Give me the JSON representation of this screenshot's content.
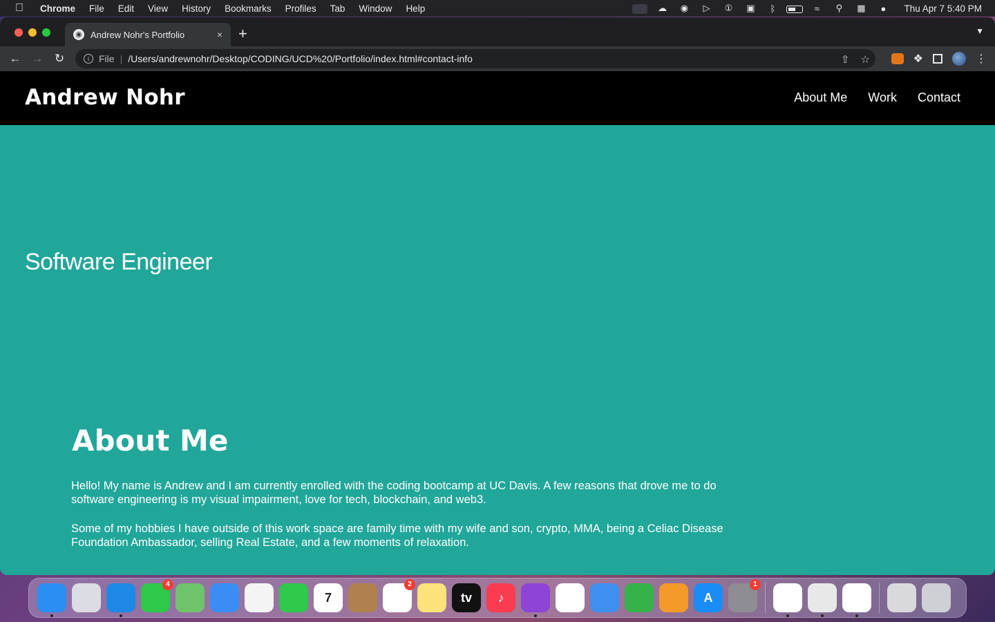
{
  "menubar": {
    "app_name": "Chrome",
    "items": [
      "File",
      "Edit",
      "View",
      "History",
      "Bookmarks",
      "Profiles",
      "Tab",
      "Window",
      "Help"
    ],
    "clock": "Thu Apr 7  5:40 PM"
  },
  "browser": {
    "tab_title": "Andrew Nohr's Portfolio",
    "tab_close": "×",
    "new_tab": "+",
    "scheme_label": "File",
    "url": "/Users/andrewnohr/Desktop/CODING/UCD%20/Portfolio/index.html#contact-info"
  },
  "site": {
    "brand": "Andrew Nohr",
    "nav": [
      "About Me",
      "Work",
      "Contact"
    ],
    "hero_title": "Software Engineer",
    "about_heading": "About Me",
    "about_paragraphs": [
      "Hello! My name is Andrew and I am currently enrolled with the coding bootcamp at UC Davis. A few reasons that drove me to do software engineering is my visual impairment, love for tech, blockchain, and web3.",
      "Some of my hobbies I have outside of this work space are family time with my wife and son, crypto, MMA, being a Celiac Disease Foundation Ambassador, selling Real Estate, and a few moments of relaxation."
    ],
    "colors": {
      "page_bg": "#21a69a",
      "header_bg": "#000000",
      "text": "#ffffff"
    }
  },
  "dock": {
    "apps": [
      {
        "name": "finder-icon",
        "color": "#2a8ef2",
        "running": true
      },
      {
        "name": "launchpad-icon",
        "color": "#dcdce4",
        "running": false
      },
      {
        "name": "safari-icon",
        "color": "#1e88e5",
        "running": true
      },
      {
        "name": "messages-icon",
        "color": "#2ec84b",
        "running": false,
        "badge": "4"
      },
      {
        "name": "maps-icon",
        "color": "#6fc36a",
        "running": false
      },
      {
        "name": "mail-icon",
        "color": "#3a8df5",
        "running": false
      },
      {
        "name": "photos-icon",
        "color": "#f4f4f4",
        "running": false
      },
      {
        "name": "facetime-icon",
        "color": "#2ec84b",
        "running": false
      },
      {
        "name": "calendar-icon",
        "color": "#ffffff",
        "running": false,
        "label": "7"
      },
      {
        "name": "contacts-icon",
        "color": "#b0814f",
        "running": false
      },
      {
        "name": "reminders-icon",
        "color": "#ffffff",
        "running": false,
        "badge": "2"
      },
      {
        "name": "notes-icon",
        "color": "#fbe27a",
        "running": false
      },
      {
        "name": "tv-icon",
        "color": "#111111",
        "running": false,
        "label": "tv"
      },
      {
        "name": "music-icon",
        "color": "#fa3c50",
        "running": false,
        "label": "♪"
      },
      {
        "name": "podcasts-icon",
        "color": "#8e44d6",
        "running": true
      },
      {
        "name": "news-icon",
        "color": "#ffffff",
        "running": false
      },
      {
        "name": "keynote-icon",
        "color": "#3f8ff0",
        "running": false
      },
      {
        "name": "numbers-icon",
        "color": "#35b34a",
        "running": false
      },
      {
        "name": "pages-icon",
        "color": "#f39a2b",
        "running": false
      },
      {
        "name": "app-store-icon",
        "color": "#1a8cf5",
        "running": false,
        "label": "A"
      },
      {
        "name": "system-preferences-icon",
        "color": "#8d8d93",
        "running": false,
        "badge": "1"
      }
    ],
    "apps_right": [
      {
        "name": "slack-icon",
        "color": "#ffffff",
        "running": true
      },
      {
        "name": "chrome-icon",
        "color": "#e8e8e8",
        "running": true
      },
      {
        "name": "vscode-icon",
        "color": "#ffffff",
        "running": true
      }
    ],
    "trash_side": [
      {
        "name": "docs-folder-icon",
        "color": "#d9d9dd",
        "running": false
      },
      {
        "name": "trash-icon",
        "color": "#cfcfd6",
        "running": false
      }
    ]
  }
}
